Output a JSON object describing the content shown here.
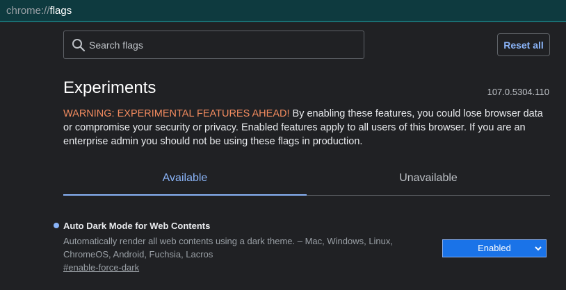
{
  "address_bar": {
    "scheme": "chrome://",
    "host": "flags"
  },
  "search": {
    "placeholder": "Search flags"
  },
  "reset_button": {
    "label": "Reset all"
  },
  "header": {
    "title": "Experiments",
    "version": "107.0.5304.110"
  },
  "warning": {
    "strong": "WARNING: EXPERIMENTAL FEATURES AHEAD!",
    "text": " By enabling these features, you could lose browser data or compromise your security or privacy. Enabled features apply to all users of this browser. If you are an enterprise admin you should not be using these flags in production."
  },
  "tabs": [
    {
      "label": "Available",
      "active": true
    },
    {
      "label": "Unavailable",
      "active": false
    }
  ],
  "flags": [
    {
      "name": "Auto Dark Mode for Web Contents",
      "description": "Automatically render all web contents using a dark theme. – Mac, Windows, Linux, ChromeOS, Android, Fuchsia, Lacros",
      "link": "#enable-force-dark",
      "selected": "Enabled"
    }
  ],
  "colors": {
    "accent": "#8ab4f8",
    "warning": "#f28b5f",
    "select_bg": "#1a73e8",
    "background": "#202124"
  }
}
